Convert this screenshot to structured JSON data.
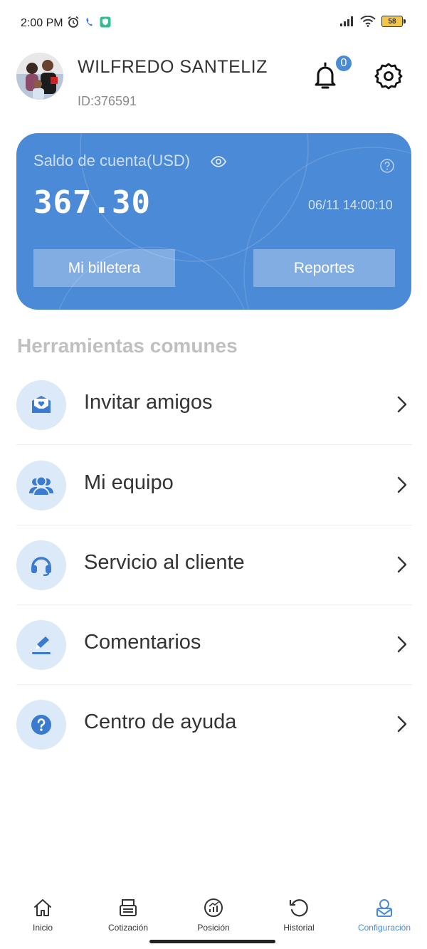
{
  "status_bar": {
    "time": "2:00 PM",
    "battery": "58",
    "icons_left": [
      "alarm-icon",
      "call-icon",
      "shield-app-icon"
    ],
    "icons_right": [
      "signal-icon",
      "wifi-icon",
      "battery-icon"
    ]
  },
  "profile": {
    "name": "WILFREDO SANTELIZ",
    "id_text": "ID:376591",
    "notifications_count": "0"
  },
  "balance_card": {
    "label": "Saldo de cuenta(USD)",
    "amount": "367.30",
    "timestamp": "06/11 14:00:10",
    "wallet_button": "Mi billetera",
    "reports_button": "Reportes",
    "color": "#4b8ad6"
  },
  "tools": {
    "title": "Herramientas comunes",
    "items": [
      {
        "label": "Invitar amigos",
        "icon": "invite-mail-icon"
      },
      {
        "label": "Mi equipo",
        "icon": "team-icon"
      },
      {
        "label": "Servicio al cliente",
        "icon": "headset-icon"
      },
      {
        "label": "Comentarios",
        "icon": "edit-pen-icon"
      },
      {
        "label": "Centro de ayuda",
        "icon": "help-circle-icon"
      }
    ]
  },
  "bottom_nav": {
    "items": [
      {
        "label": "Inicio",
        "icon": "home-icon"
      },
      {
        "label": "Cotización",
        "icon": "quotes-icon"
      },
      {
        "label": "Posición",
        "icon": "position-chart-icon"
      },
      {
        "label": "Historial",
        "icon": "history-icon"
      },
      {
        "label": "Configuración",
        "icon": "settings-user-icon"
      }
    ],
    "active_index": 4,
    "accent_color": "#4a8bd6"
  }
}
